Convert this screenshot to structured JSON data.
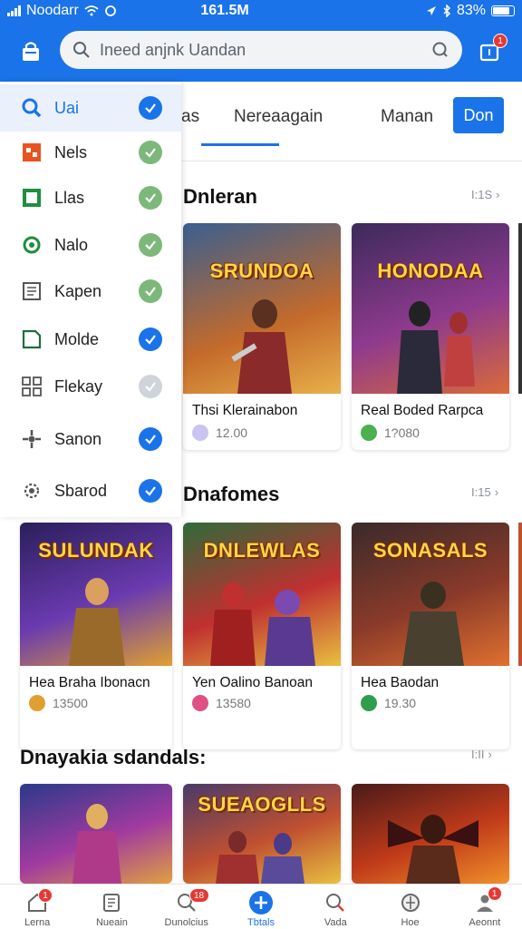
{
  "status_bar": {
    "carrier": "Noodarr",
    "time": "161.5M",
    "battery": "83%"
  },
  "app_bar": {
    "search_placeholder": "Ineed anjnk Uandan",
    "notification_count": "1"
  },
  "tabs": [
    {
      "label": "as"
    },
    {
      "label": "Nereaagain"
    },
    {
      "label": "Manan"
    }
  ],
  "done_button": "Don",
  "sidebar": {
    "items": [
      {
        "label": "Uai",
        "icon": "search-icon",
        "checked": true,
        "check_color": "#1a73e8"
      },
      {
        "label": "Nels",
        "icon": "grid-icon",
        "checked": true,
        "check_color": "#7cb87a"
      },
      {
        "label": "Llas",
        "icon": "square-icon",
        "checked": true,
        "check_color": "#7cb87a"
      },
      {
        "label": "Nalo",
        "icon": "refresh-icon",
        "checked": true,
        "check_color": "#7cb87a"
      },
      {
        "label": "Kapen",
        "icon": "document-icon",
        "checked": true,
        "check_color": "#7cb87a"
      },
      {
        "label": "Molde",
        "icon": "edit-icon",
        "checked": true,
        "check_color": "#1a73e8"
      },
      {
        "label": "Flekay",
        "icon": "apps-icon",
        "checked": false,
        "check_color": "#cfd4da"
      },
      {
        "label": "Sanon",
        "icon": "star-icon",
        "checked": true,
        "check_color": "#1a73e8"
      },
      {
        "label": "Sbarod",
        "icon": "settings-icon",
        "checked": true,
        "check_color": "#1a73e8"
      }
    ]
  },
  "sections": [
    {
      "title": "Dnleran",
      "more": "I:1S",
      "cards": [
        {
          "title": "Thsi Klerainabon",
          "meta": "12.00",
          "art_title": "SRUNDOA",
          "art_colors": [
            "#3a5f8f",
            "#c46a2b",
            "#e8b04a"
          ]
        },
        {
          "title": "Real Boded Rarpca",
          "meta": "1?080",
          "art_title": "HONODAA",
          "art_colors": [
            "#3c2a5a",
            "#8e3a8e",
            "#d96a3a"
          ]
        }
      ]
    },
    {
      "title": "Dnafomes",
      "more": "I:15",
      "cards": [
        {
          "title": "Hea Braha Ibonacn",
          "meta": "13500",
          "art_title": "SULUNDAK",
          "art_colors": [
            "#2a1f5a",
            "#6a3ab0",
            "#e0a030"
          ]
        },
        {
          "title": "Yen Oalino Banoan",
          "meta": "13580",
          "art_title": "DNLEWLAS",
          "art_colors": [
            "#2f6a3a",
            "#c03030",
            "#e8c040"
          ]
        },
        {
          "title": "Hea Baodan",
          "meta": "19.30",
          "art_title": "SONASALS",
          "art_colors": [
            "#3a2a2a",
            "#8a3a2a",
            "#e07030"
          ]
        }
      ]
    },
    {
      "title": "Dnayakia sdandals:",
      "more": "I:II",
      "cards": [
        {
          "title": "",
          "meta": "",
          "art_title": "",
          "art_colors": [
            "#2a3a8a",
            "#a03aa0",
            "#e0a040"
          ]
        },
        {
          "title": "",
          "meta": "",
          "art_title": "SUEAOGLLS",
          "art_colors": [
            "#4a3a6a",
            "#c05030",
            "#e8c040"
          ]
        },
        {
          "title": "",
          "meta": "",
          "art_title": "",
          "art_colors": [
            "#4a1a1a",
            "#c03a1a",
            "#f0902a"
          ]
        }
      ]
    }
  ],
  "bottom_nav": [
    {
      "label": "Lerna",
      "icon": "home-icon",
      "badge": "1"
    },
    {
      "label": "Nueain",
      "icon": "calendar-icon",
      "badge": ""
    },
    {
      "label": "Dunolcius",
      "icon": "search-icon",
      "badge": "18"
    },
    {
      "label": "Tbtals",
      "icon": "add-icon",
      "badge": ""
    },
    {
      "label": "Vada",
      "icon": "magnify-icon",
      "badge": ""
    },
    {
      "label": "Hoe",
      "icon": "globe-icon",
      "badge": ""
    },
    {
      "label": "Aeonnt",
      "icon": "account-icon",
      "badge": "1"
    }
  ]
}
